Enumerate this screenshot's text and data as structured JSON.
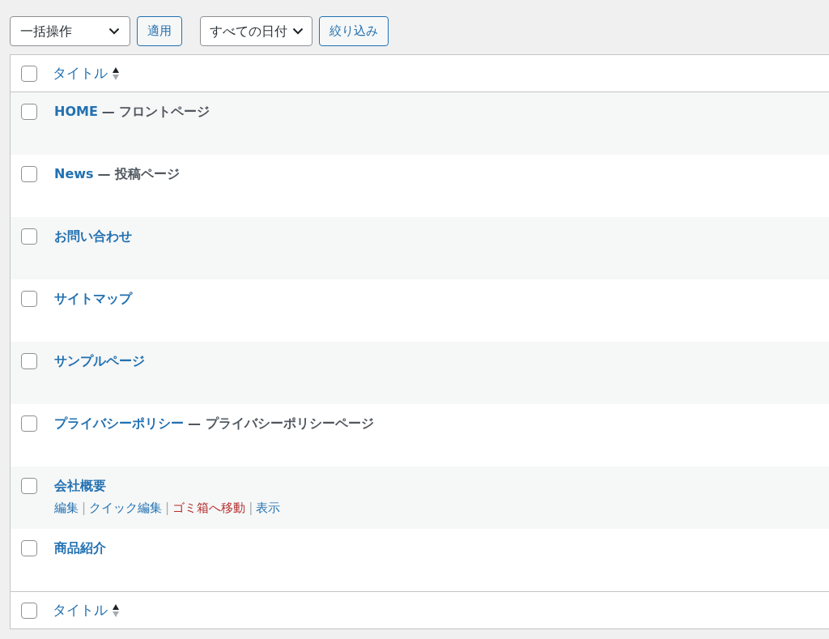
{
  "toolbar": {
    "bulk_action": {
      "value": "一括操作"
    },
    "apply_button": "適用",
    "date_filter": {
      "value": "すべての日付"
    },
    "filter_button": "絞り込み"
  },
  "table": {
    "header": {
      "checked": false,
      "column": "タイトル"
    },
    "rows": [
      {
        "title": "HOME",
        "state": "— フロントページ",
        "checked": false
      },
      {
        "title": "News",
        "state": "— 投稿ページ",
        "checked": false
      },
      {
        "title": "お問い合わせ",
        "checked": false
      },
      {
        "title": "サイトマップ",
        "checked": false
      },
      {
        "title": "サンプルページ",
        "checked": false
      },
      {
        "title": "プライバシーポリシー",
        "state": "— プライバシーポリシーページ",
        "checked": false
      },
      {
        "title": "会社概要",
        "checked": false,
        "actions": [
          {
            "label": "編集",
            "kind": "normal"
          },
          {
            "label": "クイック編集",
            "kind": "normal"
          },
          {
            "label": "ゴミ箱へ移動",
            "kind": "trash"
          },
          {
            "label": "表示",
            "kind": "normal"
          }
        ],
        "action_separator": "|"
      },
      {
        "title": "商品紹介",
        "checked": false
      }
    ],
    "footer": {
      "checked": false,
      "column": "タイトル"
    }
  }
}
